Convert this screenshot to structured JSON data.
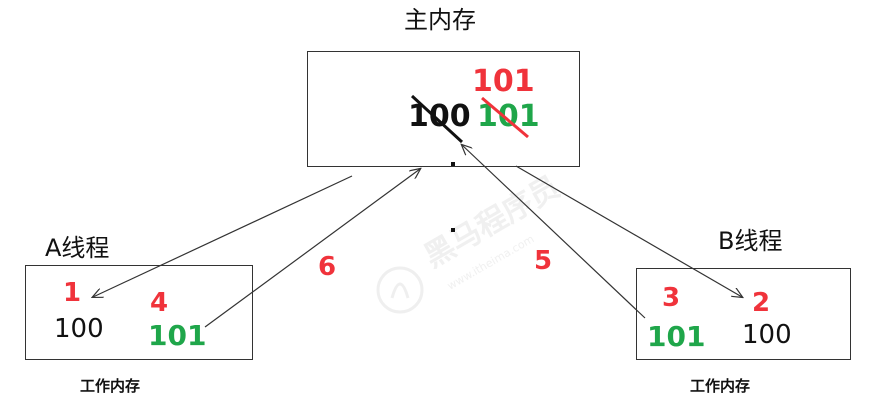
{
  "main_memory": {
    "title": "主内存",
    "old_value": "100",
    "crossed_value": "101",
    "new_value": "101"
  },
  "thread_a": {
    "title": "A线程",
    "step_read": "1",
    "read_value": "100",
    "step_write": "4",
    "written_value": "101",
    "caption": "工作内存"
  },
  "thread_b": {
    "title": "B线程",
    "step_read": "2",
    "read_value": "100",
    "step_write": "3",
    "written_value": "101",
    "caption": "工作内存"
  },
  "arrow_labels": {
    "a_write_back": "6",
    "b_write_back": "5"
  },
  "watermark": {
    "text": "黑马程序员",
    "url_text": "www.itheima.com"
  },
  "colors": {
    "red": "#f0333b",
    "green": "#1fa64a",
    "black": "#111111",
    "line": "#333333",
    "watermark": "#e6e6e6"
  }
}
